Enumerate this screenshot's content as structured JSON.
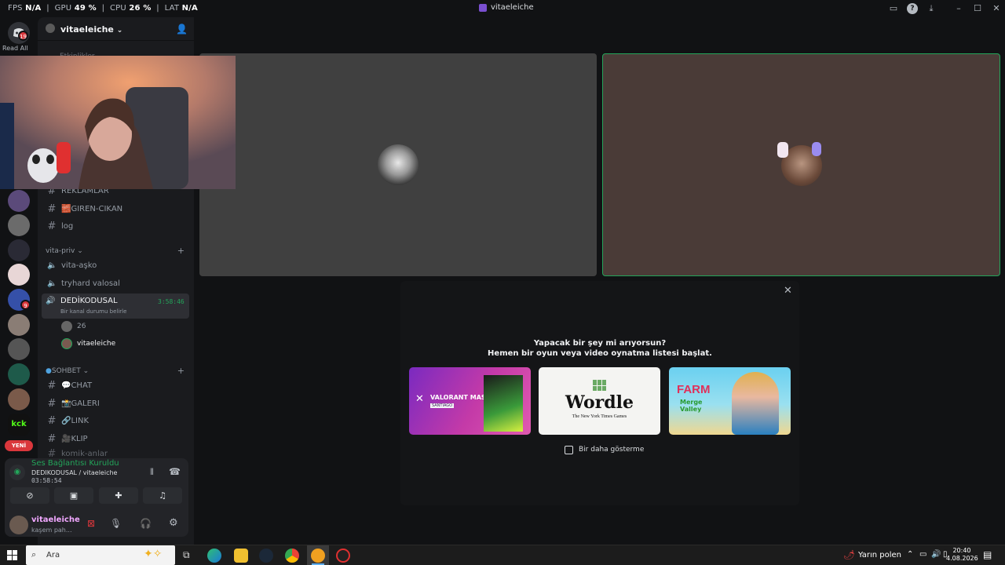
{
  "perf": {
    "fps_label": "FPS",
    "fps_value": "N/A",
    "gpu_label": "GPU",
    "gpu_value": "49 %",
    "cpu_label": "CPU",
    "cpu_value": "26 %",
    "lat_label": "LAT",
    "lat_value": "N/A"
  },
  "window": {
    "title": "vitaeleiche"
  },
  "rail": {
    "read_all": "Read All",
    "dm_badge": "19",
    "badge_2": "9",
    "new_label": "YENİ"
  },
  "server": {
    "name": "vitaeleiche",
    "partial_channel": "Etkinlikler"
  },
  "channels": [
    {
      "name": "REKLAMLAR"
    },
    {
      "name": "🧱GIREN-CIKAN"
    },
    {
      "name": "log"
    }
  ],
  "category_priv": {
    "name": "vita-priv"
  },
  "voice_channels": [
    {
      "name": "vita-aşko"
    },
    {
      "name": "tryhard valosal"
    }
  ],
  "active_voice": {
    "name": "DEDİKODUSAL",
    "timer": "3:58:46",
    "status": "Bir kanal durumu belirle"
  },
  "voice_users": [
    {
      "name": "26"
    },
    {
      "name": "vitaeleiche"
    }
  ],
  "category_sohbet": {
    "name": "SOHBET"
  },
  "sohbet_channels": [
    {
      "name": "💬CHAT"
    },
    {
      "name": "📸GALERI"
    },
    {
      "name": "🔗LINK"
    },
    {
      "name": "🎥KLIP"
    },
    {
      "name": "komik-anlar"
    }
  ],
  "voice_panel": {
    "status": "Ses Bağlantısı Kuruldu",
    "channel": "DEDIKODUSAL / vitaeleiche",
    "time": "03:58:54"
  },
  "user": {
    "name": "vitaeleiche",
    "status": "kaşem pah..."
  },
  "modal": {
    "line1": "Yapacak bir şey mi arıyorsun?",
    "line2": "Hemen bir oyun veya video oynatma listesi başlat.",
    "checkbox_label": "Bir daha gösterme",
    "cards": [
      {
        "title": "VALORANT MASTERS",
        "sub": "SANTIAGO"
      },
      {
        "title": "Wordle",
        "sub": "The New York Times Games"
      },
      {
        "title": "FARM",
        "sub": "Merge Valley"
      }
    ]
  },
  "taskbar": {
    "search_placeholder": "Ara",
    "weather": "Yarın polen",
    "time": "20:40",
    "date": "4.08.2026"
  },
  "colors": {
    "accent_green": "#23a55a",
    "danger": "#da373c",
    "blurple": "#5865f2"
  }
}
